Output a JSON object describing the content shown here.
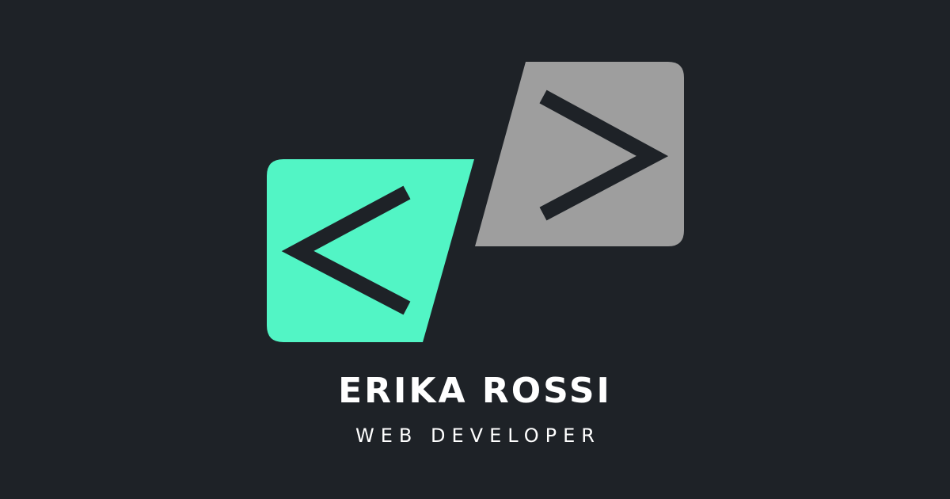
{
  "brand": {
    "name": "ERIKA ROSSI",
    "role": "WEB DEVELOPER"
  },
  "logo": {
    "left_glyph": "less-than-icon",
    "right_glyph": "greater-than-icon"
  },
  "colors": {
    "background": "#1e2227",
    "left_panel": "#52f5c5",
    "right_panel": "#9e9e9e",
    "glyph": "#1e2227",
    "text": "#ffffff"
  }
}
